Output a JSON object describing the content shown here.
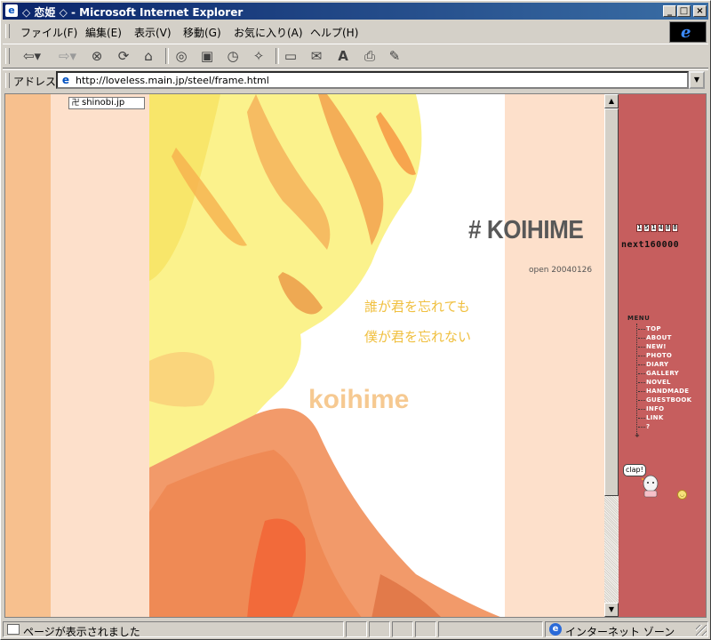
{
  "window": {
    "icon": "e",
    "title": "◇ 恋姫 ◇ - Microsoft Internet Explorer",
    "minimize": "_",
    "maximize": "□",
    "close": "×"
  },
  "menubar": {
    "items": [
      "ファイル(F)",
      "編集(E)",
      "表示(V)",
      "移動(G)",
      "お気に入り(A)",
      "ヘルプ(H)"
    ]
  },
  "toolbar": {
    "icons": [
      "back-icon",
      "forward-icon",
      "stop-icon",
      "refresh-icon",
      "home-icon",
      "search-icon",
      "favorites-icon",
      "history-icon",
      "channels-icon",
      "fullscreen-icon",
      "mail-icon",
      "font-icon",
      "print-icon",
      "edit-icon"
    ]
  },
  "address": {
    "label": "アドレス",
    "url": "http://loveless.main.jp/steel/frame.html"
  },
  "page": {
    "badge": "shinobi.jp",
    "heading": "# KOIHIME",
    "open_date": "open 20040126",
    "poem_line1": "誰が君を忘れても",
    "poem_line2": "僕が君を忘れない",
    "wordmark": "koihime"
  },
  "side": {
    "counter_digits": [
      "1",
      "5",
      "1",
      "4",
      "8",
      "8"
    ],
    "next": "next160000",
    "menu_title": "MENU",
    "menu_items": [
      "TOP",
      "ABOUT",
      "NEW!",
      "PHOTO",
      "DIARY",
      "GALLERY",
      "NOVEL",
      "HANDMADE",
      "GUESTBOOK",
      "INFO",
      "LINK",
      "?"
    ],
    "menu_end": "+",
    "clap": "clap!"
  },
  "status": {
    "message": "ページが表示されました",
    "zone": "インターネット ゾーン"
  },
  "colors": {
    "titlebar": "#0a246a",
    "side_frame": "#c65e5e",
    "heading": "#585858",
    "poem": "#f0c040",
    "wordmark": "#f6c991"
  }
}
